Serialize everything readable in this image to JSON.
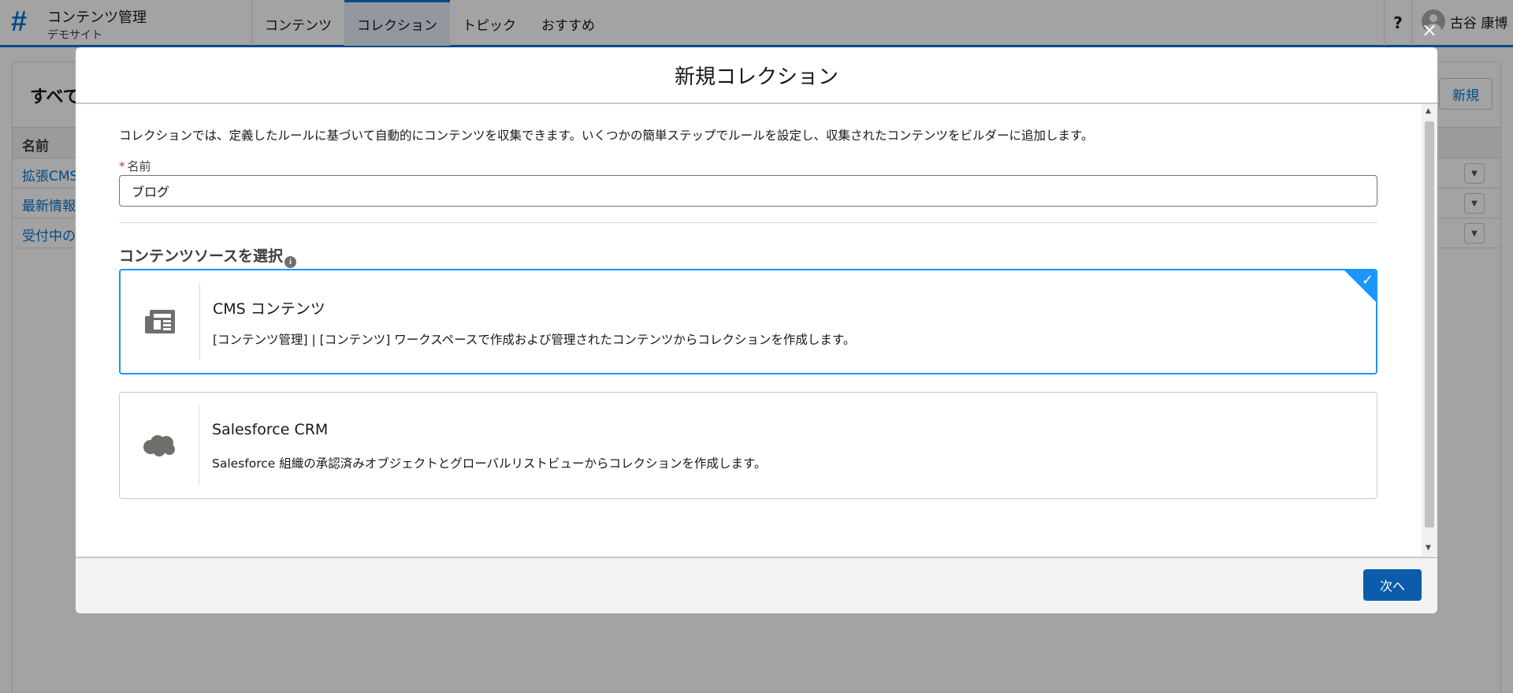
{
  "app": {
    "title": "コンテンツ管理",
    "subtitle": "デモサイト",
    "logo_glyph": "#"
  },
  "nav": {
    "items": [
      {
        "label": "コンテンツ",
        "active": false
      },
      {
        "label": "コレクション",
        "active": true
      },
      {
        "label": "トピック",
        "active": false
      },
      {
        "label": "おすすめ",
        "active": false
      }
    ]
  },
  "header": {
    "help_label": "?",
    "user_name": "古谷 康博"
  },
  "list": {
    "title": "すべて",
    "new_button": "新規",
    "column_name": "名前",
    "rows": [
      {
        "name": "拡張CMS"
      },
      {
        "name": "最新情報"
      },
      {
        "name": "受付中の"
      }
    ]
  },
  "modal": {
    "title": "新規コレクション",
    "close_label": "×",
    "intro": "コレクションでは、定義したルールに基づいて自動的にコンテンツを収集できます。いくつかの簡単ステップでルールを設定し、収集されたコンテンツをビルダーに追加します。",
    "name_field": {
      "required_mark": "*",
      "label": "名前",
      "value": "ブログ"
    },
    "source_heading": "コンテンツソースを選択",
    "sources": [
      {
        "title": "CMS コンテンツ",
        "description": "[コンテンツ管理] | [コンテンツ] ワークスペースで作成および管理されたコンテンツからコレクションを作成します。",
        "icon": "news-icon",
        "selected": true
      },
      {
        "title": "Salesforce CRM",
        "description": "Salesforce 組織の承認済みオブジェクトとグローバルリストビューからコレクションを作成します。",
        "icon": "cloud-icon",
        "selected": false
      }
    ],
    "next_button": "次へ"
  },
  "colors": {
    "brand": "#0176d3",
    "selected_border": "#1b96ff",
    "primary_button": "#0b5cab",
    "required": "#c23934"
  }
}
